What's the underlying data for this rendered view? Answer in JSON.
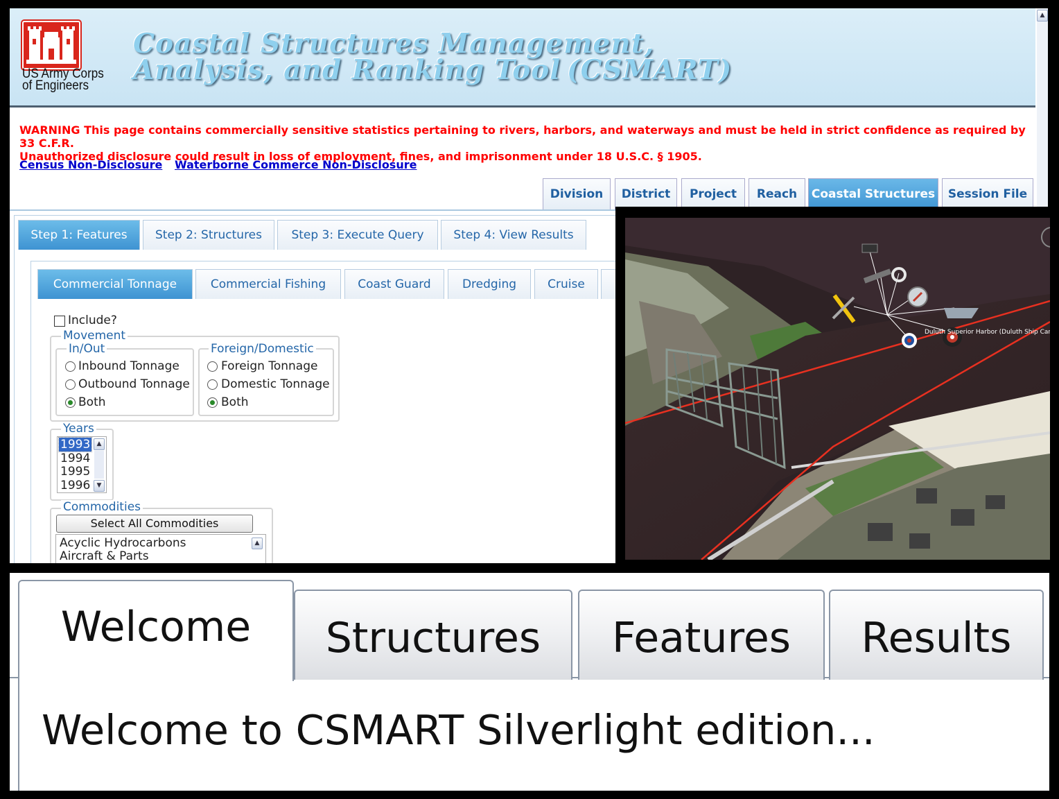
{
  "header": {
    "org_line1": "US Army Corps",
    "org_line2": "of Engineers",
    "title_line1": "Coastal Structures Management,",
    "title_line2": "Analysis, and Ranking Tool",
    "title_abbrev": "(CSMART)"
  },
  "warning": {
    "line1": "WARNING This page contains commercially sensitive statistics pertaining to rivers, harbors, and waterways and must be held in strict confidence as required by 33 C.F.R.",
    "line2": "Unauthorized disclosure could result in loss of employment, fines, and imprisonment under 18 U.S.C. § 1905."
  },
  "links": {
    "census": "Census Non-Disclosure",
    "waterborne": "Waterborne Commerce Non-Disclosure"
  },
  "main_tabs": [
    {
      "label": "Division"
    },
    {
      "label": "District"
    },
    {
      "label": "Project"
    },
    {
      "label": "Reach"
    },
    {
      "label": "Coastal Structures",
      "selected": true
    },
    {
      "label": "Session File"
    }
  ],
  "step_tabs": [
    {
      "label": "Step 1: Features",
      "selected": true
    },
    {
      "label": "Step 2: Structures"
    },
    {
      "label": "Step 3: Execute Query"
    },
    {
      "label": "Step 4: View Results"
    }
  ],
  "feature_tabs": [
    {
      "label": "Commercial Tonnage",
      "selected": true
    },
    {
      "label": "Commercial Fishing"
    },
    {
      "label": "Coast Guard"
    },
    {
      "label": "Dredging"
    },
    {
      "label": "Cruise"
    }
  ],
  "form": {
    "include_label": "Include?",
    "include_checked": false,
    "movement_legend": "Movement",
    "inout_legend": "In/Out",
    "inout_options": [
      "Inbound Tonnage",
      "Outbound Tonnage",
      "Both"
    ],
    "inout_selected": "Both",
    "foreign_legend": "Foreign/Domestic",
    "foreign_options": [
      "Foreign Tonnage",
      "Domestic Tonnage",
      "Both"
    ],
    "foreign_selected": "Both",
    "years_legend": "Years",
    "years": [
      "1993",
      "1994",
      "1995",
      "1996"
    ],
    "years_selected": "1993",
    "commodities_legend": "Commodities",
    "select_all_label": "Select All Commodities",
    "commodities": [
      "Acyclic Hydrocarbons",
      "Aircraft & Parts"
    ]
  },
  "map": {
    "placemark_label": "Duluth Superior Harbor (Duluth Ship Canal"
  },
  "silverlight": {
    "tabs": [
      {
        "label": "Welcome",
        "selected": true
      },
      {
        "label": "Structures"
      },
      {
        "label": "Features"
      },
      {
        "label": "Results"
      }
    ],
    "welcome_text": "Welcome to CSMART Silverlight edition..."
  },
  "colors": {
    "warning": "#ff0000",
    "tab_selected": "#3f95d3",
    "link": "#0000cc",
    "usace_red": "#d9261c"
  }
}
